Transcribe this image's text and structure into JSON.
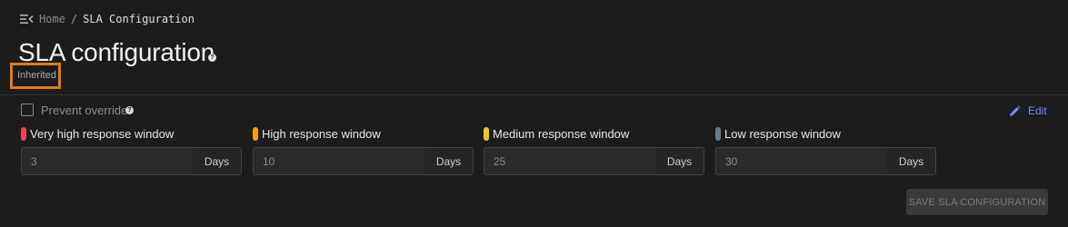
{
  "breadcrumb": {
    "home": "Home",
    "separator": "/",
    "current": "SLA Configuration"
  },
  "page": {
    "title": "SLA configuration",
    "help_icon": "question-circle-icon",
    "status_tag": "Inherited"
  },
  "override": {
    "label": "Prevent override",
    "checked": false,
    "help_icon": "question-circle-icon"
  },
  "edit": {
    "label": "Edit",
    "icon": "pencil-icon",
    "color": "#6b8cff"
  },
  "windows": [
    {
      "label": "Very high response window",
      "value": "3",
      "unit": "Days",
      "color": "#e5484d"
    },
    {
      "label": "High response window",
      "value": "10",
      "unit": "Days",
      "color": "#f59e0b"
    },
    {
      "label": "Medium response window",
      "value": "25",
      "unit": "Days",
      "color": "#f5c518"
    },
    {
      "label": "Low response window",
      "value": "30",
      "unit": "Days",
      "color": "#5f7f94"
    }
  ],
  "save": {
    "label": "SAVE SLA CONFIGURATION",
    "enabled": false
  },
  "colors": {
    "background": "#1c1c1c",
    "highlight_box": "#e07a1f"
  }
}
